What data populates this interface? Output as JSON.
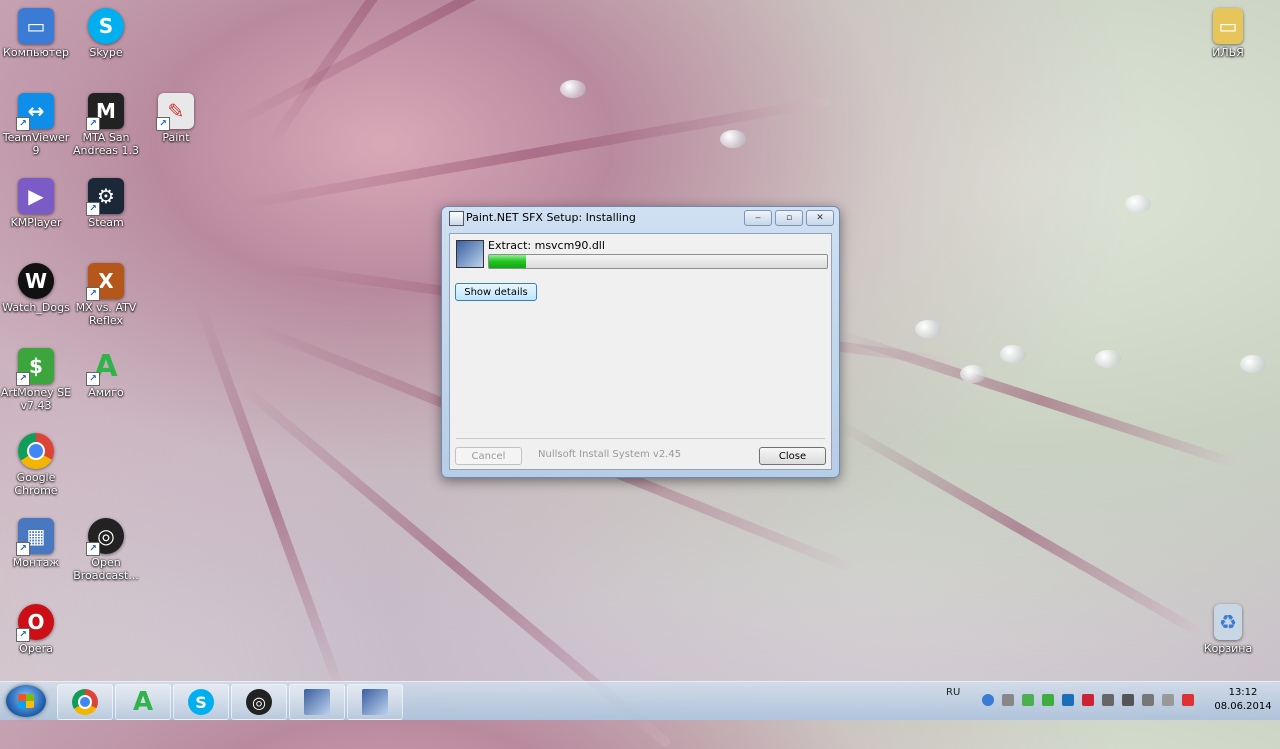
{
  "desktop": {
    "icons": [
      {
        "label": "Компьютер",
        "color": "#3a7bd5"
      },
      {
        "label": "Skype",
        "color": "#00aff0"
      },
      {
        "label": "TeamViewer 9",
        "color": "#0e8ee9"
      },
      {
        "label": "MTA San Andreas 1.3",
        "color": "#222222"
      },
      {
        "label": "Paint",
        "color": "#e8e8e8"
      },
      {
        "label": "KMPlayer",
        "color": "#7b5cc7"
      },
      {
        "label": "Steam",
        "color": "#1b2838"
      },
      {
        "label": "Watch_Dogs",
        "color": "#111111"
      },
      {
        "label": "MX vs. ATV Reflex",
        "color": "#b5561a"
      },
      {
        "label": "ArtMoney SE v7.43",
        "color": "#3da53d"
      },
      {
        "label": "Амиго",
        "color": "#2fb34a"
      },
      {
        "label": "Google Chrome",
        "color": "#db4437"
      },
      {
        "label": "Монтаж",
        "color": "#4a78c0"
      },
      {
        "label": "Open Broadcast...",
        "color": "#222222"
      },
      {
        "label": "Opera",
        "color": "#cc0f16"
      },
      {
        "label": "ИЛЬЯ",
        "color": "#e6c65a"
      },
      {
        "label": "Корзина",
        "color": "#c9d6e3"
      }
    ]
  },
  "window": {
    "title": "Paint.NET SFX Setup: Installing",
    "extract_label": "Extract: msvcm90.dll",
    "progress_percent": 11,
    "show_details": "Show details",
    "cancel": "Cancel",
    "branding": "Nullsoft Install System v2.45",
    "close": "Close"
  },
  "taskbar": {
    "lang": "RU",
    "time": "13:12",
    "date": "08.06.2014"
  }
}
